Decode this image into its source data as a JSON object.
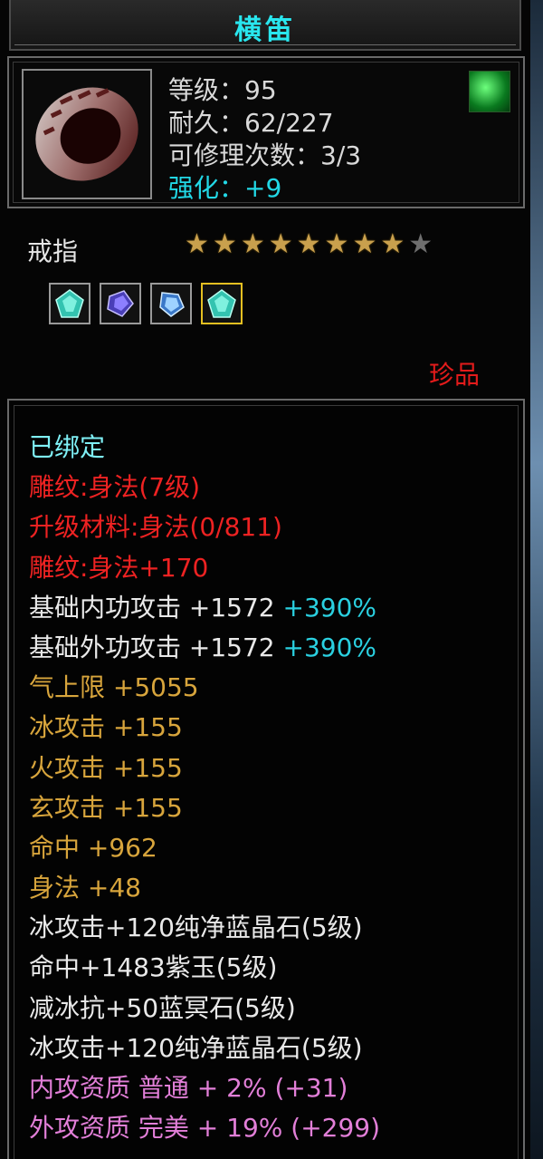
{
  "item": {
    "name": "横笛",
    "stats": [
      {
        "text": "等级：95",
        "color": "white"
      },
      {
        "text": "耐久：62/227",
        "color": "white"
      },
      {
        "text": "可修理次数：3/3",
        "color": "white"
      },
      {
        "text": "强化：+9",
        "color": "cyan"
      }
    ],
    "category": "戒指",
    "stars": {
      "filled": 8,
      "total": 9
    },
    "gems": [
      "green-gem",
      "purple-gem",
      "blue-gem",
      "green-gem-selected"
    ],
    "quality": "珍品",
    "attributes": [
      {
        "parts": [
          {
            "text": "已绑定",
            "color": "cyan"
          }
        ]
      },
      {
        "parts": [
          {
            "text": "雕纹:身法(7级)",
            "color": "red"
          }
        ]
      },
      {
        "parts": [
          {
            "text": "升级材料:身法(0/811)",
            "color": "red"
          }
        ]
      },
      {
        "parts": [
          {
            "text": "雕纹:身法+170",
            "color": "red"
          }
        ]
      },
      {
        "parts": [
          {
            "text": "基础内功攻击 +1572 ",
            "color": "white"
          },
          {
            "text": "+390%",
            "color": "tcyan"
          }
        ]
      },
      {
        "parts": [
          {
            "text": "基础外功攻击 +1572 ",
            "color": "white"
          },
          {
            "text": "+390%",
            "color": "tcyan"
          }
        ]
      },
      {
        "parts": [
          {
            "text": "气上限 +5055",
            "color": "gold"
          }
        ]
      },
      {
        "parts": [
          {
            "text": "冰攻击 +155",
            "color": "gold"
          }
        ]
      },
      {
        "parts": [
          {
            "text": "火攻击 +155",
            "color": "gold"
          }
        ]
      },
      {
        "parts": [
          {
            "text": "玄攻击 +155",
            "color": "gold"
          }
        ]
      },
      {
        "parts": [
          {
            "text": "命中 +962",
            "color": "gold"
          }
        ]
      },
      {
        "parts": [
          {
            "text": "身法 +48",
            "color": "gold"
          }
        ]
      },
      {
        "parts": [
          {
            "text": "冰攻击+120纯净蓝晶石(5级)",
            "color": "white"
          }
        ]
      },
      {
        "parts": [
          {
            "text": "命中+1483紫玉(5级)",
            "color": "white"
          }
        ]
      },
      {
        "parts": [
          {
            "text": "减冰抗+50蓝冥石(5级)",
            "color": "white"
          }
        ]
      },
      {
        "parts": [
          {
            "text": "冰攻击+120纯净蓝晶石(5级)",
            "color": "white"
          }
        ]
      },
      {
        "parts": [
          {
            "text": "内攻资质 普通 + 2% (+31)",
            "color": "pink"
          }
        ]
      },
      {
        "parts": [
          {
            "text": "外攻资质 完美 + 19% (+299)",
            "color": "pink"
          }
        ]
      }
    ]
  },
  "colors": {
    "white": "#e9e9e9",
    "cyan": "#7ff0f6",
    "red": "#ee2222",
    "gold": "#d8a53c",
    "pink": "#e27fd8",
    "tcyan": "#2ad0e0",
    "title": "#29e6ee",
    "quality": "#e31b1b"
  }
}
